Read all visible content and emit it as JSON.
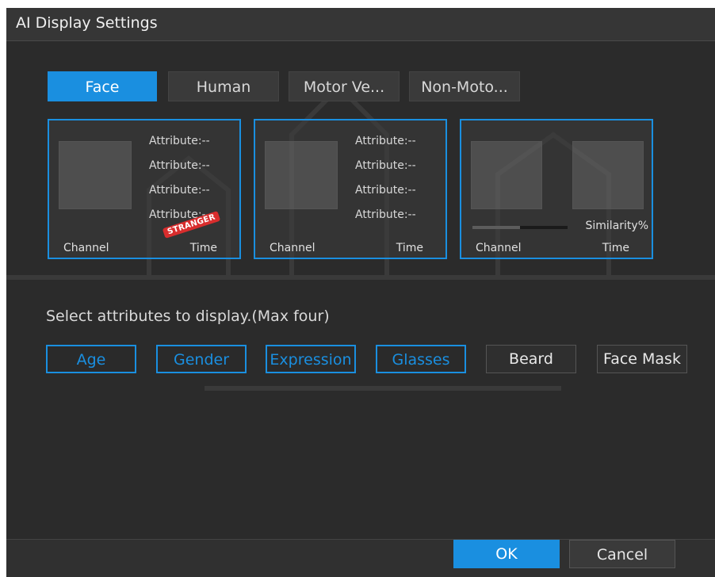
{
  "window": {
    "title": "AI Display Settings"
  },
  "tabs": [
    {
      "label": "Face",
      "active": true
    },
    {
      "label": "Human",
      "active": false
    },
    {
      "label": "Motor Ve...",
      "active": false
    },
    {
      "label": "Non-Moto...",
      "active": false
    }
  ],
  "cards": [
    {
      "attributes": [
        "Attribute:--",
        "Attribute:--",
        "Attribute:--",
        "Attribute:--"
      ],
      "badge": "STRANGER",
      "channel_label": "Channel",
      "time_label": "Time"
    },
    {
      "attributes": [
        "Attribute:--",
        "Attribute:--",
        "Attribute:--",
        "Attribute:--"
      ],
      "channel_label": "Channel",
      "time_label": "Time"
    },
    {
      "similarity_label": "Similarity%",
      "channel_label": "Channel",
      "time_label": "Time"
    }
  ],
  "hint": "Select attributes to display.(Max four)",
  "options": [
    {
      "label": "Age",
      "selected": true
    },
    {
      "label": "Gender",
      "selected": true
    },
    {
      "label": "Expression",
      "selected": true
    },
    {
      "label": "Glasses",
      "selected": true
    },
    {
      "label": "Beard",
      "selected": false
    },
    {
      "label": "Face Mask",
      "selected": false
    }
  ],
  "buttons": {
    "ok": "OK",
    "cancel": "Cancel"
  },
  "colors": {
    "accent": "#1a8fe0",
    "window_bg": "#2b2b2b",
    "badge": "#d92d2d"
  }
}
